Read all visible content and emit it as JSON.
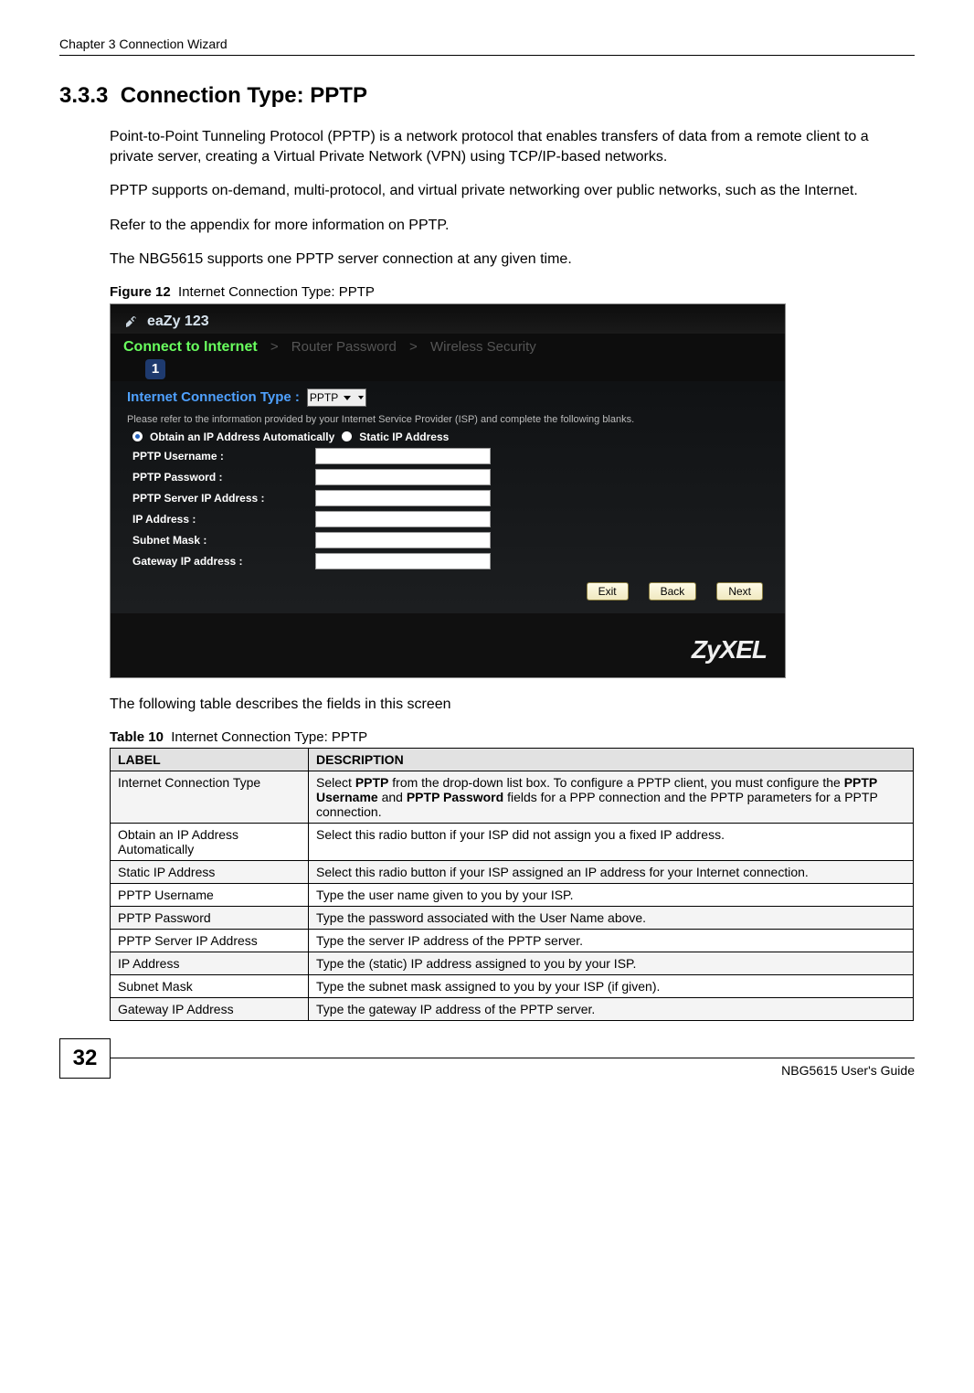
{
  "header": {
    "chapter": "Chapter 3 Connection Wizard"
  },
  "section": {
    "number": "3.3.3",
    "title": "Connection Type: PPTP"
  },
  "paragraphs": {
    "p1": "Point-to-Point Tunneling Protocol (PPTP) is a network protocol that enables transfers of data from a remote client to a private server, creating a Virtual Private Network (VPN) using TCP/IP-based networks.",
    "p2": "PPTP supports on-demand, multi-protocol, and virtual private networking over public networks, such as the Internet.",
    "p3": "Refer to the appendix for more information on PPTP.",
    "p4": "The NBG5615 supports one PPTP server connection at any given time."
  },
  "figure": {
    "label": "Figure 12",
    "caption": "Internet Connection Type: PPTP"
  },
  "screenshot": {
    "logo": "eaZy 123",
    "steps": {
      "active": "Connect to Internet",
      "s2": "Router Password",
      "s3": "Wireless Security",
      "badge": "1"
    },
    "connTypeLabel": "Internet Connection Type :",
    "connTypeValue": "PPTP",
    "hint": "Please refer to the information provided by your Internet Service Provider (ISP) and complete the following blanks.",
    "radioAuto": "Obtain an IP Address Automatically",
    "radioStatic": "Static IP Address",
    "fields": [
      "PPTP Username :",
      "PPTP Password :",
      "PPTP Server IP Address :",
      "IP Address :",
      "Subnet Mask :",
      "Gateway IP address :"
    ],
    "buttons": {
      "exit": "Exit",
      "back": "Back",
      "next": "Next"
    },
    "brand": "ZyXEL"
  },
  "tableIntro": "The following table describes the fields in this screen",
  "table": {
    "label": "Table 10",
    "caption": "Internet Connection Type: PPTP",
    "headers": [
      "LABEL",
      "DESCRIPTION"
    ],
    "rows": [
      {
        "label": "Internet Connection Type",
        "desc_pre": "Select ",
        "desc_b1": "PPTP",
        "desc_mid1": " from the drop-down list box. To configure a PPTP client, you must configure the ",
        "desc_b2": "PPTP Username",
        "desc_mid2": " and ",
        "desc_b3": "PPTP Password",
        "desc_post": " fields for a PPP connection and the PPTP parameters for a PPTP connection."
      },
      {
        "label": "Obtain an IP Address Automatically",
        "desc": "Select this radio button if your ISP did not assign you a fixed IP address."
      },
      {
        "label": "Static IP Address",
        "desc": "Select this radio button if your ISP assigned an IP address for your Internet connection."
      },
      {
        "label": "PPTP Username",
        "desc": "Type the user name given to you by your ISP."
      },
      {
        "label": "PPTP Password",
        "desc": "Type the password associated with the User Name above."
      },
      {
        "label": "PPTP Server IP Address",
        "desc": "Type the server IP address of the PPTP server."
      },
      {
        "label": "IP Address",
        "desc": "Type the (static) IP address assigned to you by your ISP."
      },
      {
        "label": "Subnet Mask",
        "desc": "Type the subnet mask assigned to you by your ISP (if given)."
      },
      {
        "label": "Gateway IP Address",
        "desc": "Type the gateway IP address of the PPTP server."
      }
    ]
  },
  "footer": {
    "pageNum": "32",
    "guide": "NBG5615 User's Guide"
  }
}
